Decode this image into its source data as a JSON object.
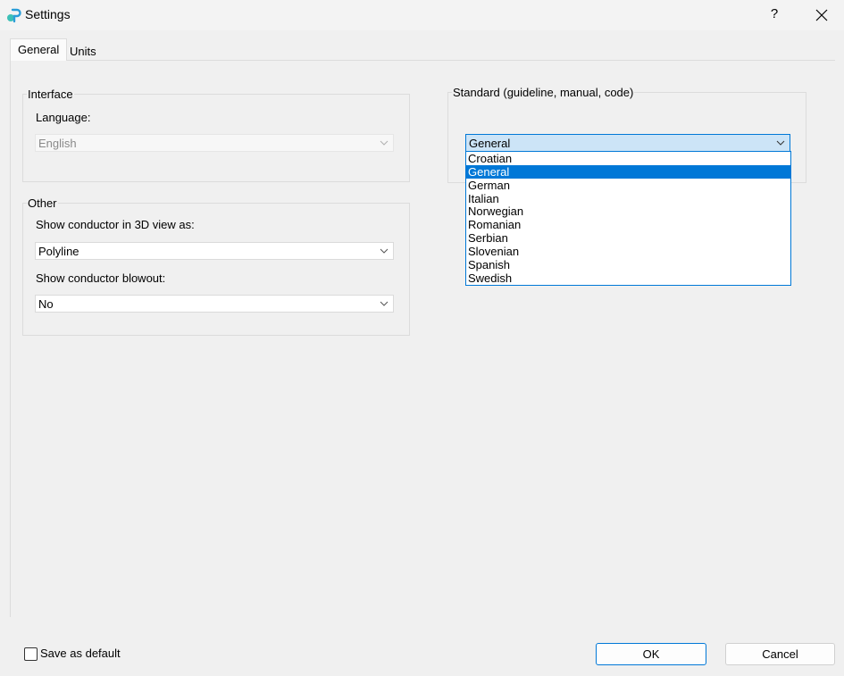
{
  "window": {
    "title": "Settings",
    "help_label": "?"
  },
  "tabs": [
    {
      "label": "General",
      "active": true
    },
    {
      "label": "Units",
      "active": false
    }
  ],
  "interface": {
    "group_title": "Interface",
    "language_label": "Language:",
    "language_value": "English"
  },
  "other": {
    "group_title": "Other",
    "conductor_view_label": "Show conductor in 3D view as:",
    "conductor_view_value": "Polyline",
    "blowout_label": "Show conductor blowout:",
    "blowout_value": "No"
  },
  "standard": {
    "group_title": "Standard (guideline, manual, code)",
    "selected": "General",
    "options": [
      "Croatian",
      "General",
      "German",
      "Italian",
      "Norwegian",
      "Romanian",
      "Serbian",
      "Slovenian",
      "Spanish",
      "Swedish"
    ]
  },
  "footer": {
    "save_default_label": "Save as default",
    "ok_label": "OK",
    "cancel_label": "Cancel"
  },
  "colors": {
    "accent": "#0078d7",
    "window_bg": "#f0f0f0",
    "selection_bg": "#0078d7",
    "combo_active_bg": "#cce4f7"
  }
}
